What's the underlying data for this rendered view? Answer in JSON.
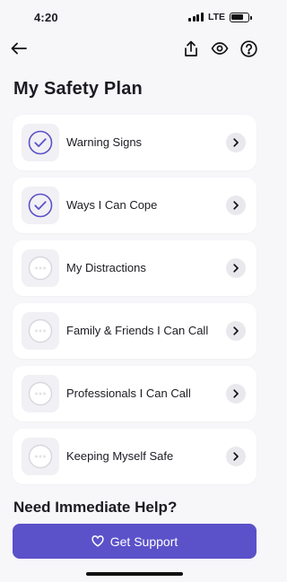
{
  "status_bar": {
    "time": "4:20",
    "network": "LTE"
  },
  "nav": {
    "back_icon": "back-arrow-icon",
    "action_icons": [
      "share-icon",
      "eye-icon",
      "help-circle-icon"
    ]
  },
  "page": {
    "title": "My Safety Plan"
  },
  "plan_items": [
    {
      "label": "Warning Signs",
      "completed": true
    },
    {
      "label": "Ways I Can Cope",
      "completed": true
    },
    {
      "label": "My Distractions",
      "completed": false
    },
    {
      "label": "Family & Friends I Can Call",
      "completed": false
    },
    {
      "label": "Professionals I Can Call",
      "completed": false
    },
    {
      "label": "Keeping Myself Safe",
      "completed": false
    }
  ],
  "help": {
    "title": "Need Immediate Help?",
    "button_label": "Get Support",
    "button_icon": "heart-icon"
  },
  "colors": {
    "accent": "#5b51c9",
    "background": "#f7f6f9",
    "card": "#ffffff"
  }
}
